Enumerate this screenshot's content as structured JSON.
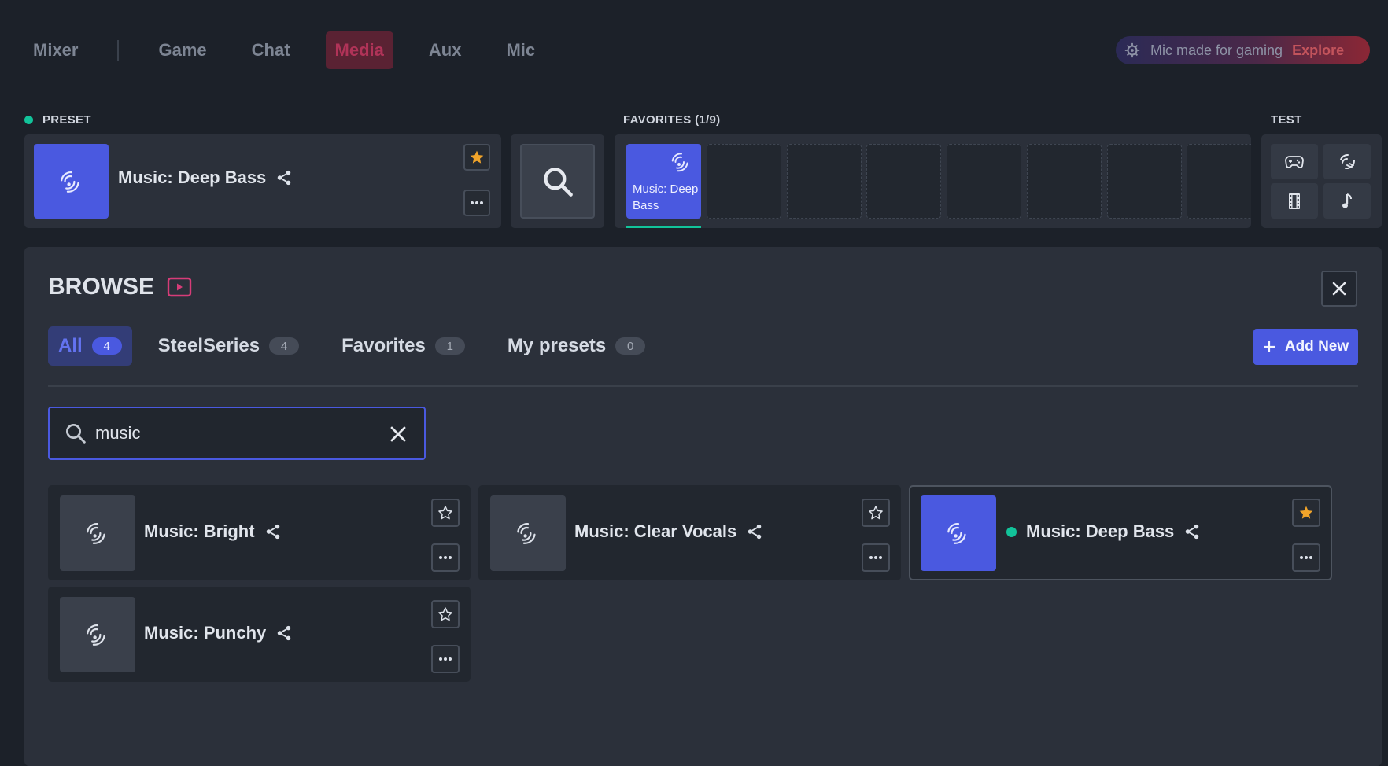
{
  "nav": {
    "tabs": [
      {
        "label": "Mixer"
      },
      {
        "label": "Game"
      },
      {
        "label": "Chat"
      },
      {
        "label": "Media"
      },
      {
        "label": "Aux"
      },
      {
        "label": "Mic"
      }
    ],
    "active": "Media"
  },
  "promo": {
    "text": "Mic made for gaming",
    "link": "Explore"
  },
  "preset": {
    "label": "PRESET",
    "name": "Music: Deep Bass",
    "favorited": true
  },
  "favorites": {
    "label": "FAVORITES (1/9)",
    "items": [
      {
        "name": "Music: Deep Bass"
      }
    ],
    "empty_slots": 7
  },
  "test": {
    "label": "TEST",
    "buttons": [
      "gamepad-icon",
      "chat-waves-icon",
      "film-icon",
      "music-note-icon"
    ]
  },
  "browse": {
    "title": "BROWSE",
    "filters": [
      {
        "label": "All",
        "count": "4"
      },
      {
        "label": "SteelSeries",
        "count": "4"
      },
      {
        "label": "Favorites",
        "count": "1"
      },
      {
        "label": "My presets",
        "count": "0"
      }
    ],
    "add_new": "Add New",
    "search": {
      "value": "music"
    },
    "presets": [
      {
        "name": "Music: Bright",
        "favorited": false,
        "active": false
      },
      {
        "name": "Music: Clear Vocals",
        "favorited": false,
        "active": false
      },
      {
        "name": "Music: Deep Bass",
        "favorited": true,
        "active": true
      },
      {
        "name": "Music: Punchy",
        "favorited": false,
        "active": false
      }
    ]
  },
  "colors": {
    "accent_blue": "#4a59e0",
    "active_dot": "#12c39a",
    "star_gold": "#f1a42a",
    "media_tab": "#b03358",
    "background": "#1c2129"
  }
}
